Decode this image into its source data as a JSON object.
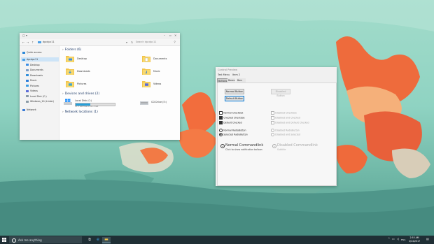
{
  "explorer": {
    "title": "",
    "address_path": "dpcdpc11",
    "search_placeholder": "Search dpcdpc11",
    "nav": {
      "back": "←",
      "forward": "→",
      "up": "↑"
    },
    "sidebar": [
      {
        "label": "Quick access",
        "icon": "star-icon",
        "color": "#2b88d8"
      },
      {
        "label": "dpcdpc11",
        "icon": "computer-icon",
        "color": "#4aa0e6",
        "selected": true
      },
      {
        "label": "Desktop",
        "icon": "desktop-icon",
        "color": "#3a8ee6"
      },
      {
        "label": "Documents",
        "icon": "documents-icon",
        "color": "#7a9cc6"
      },
      {
        "label": "Downloads",
        "icon": "downloads-icon",
        "color": "#2f8fdc"
      },
      {
        "label": "Music",
        "icon": "music-icon",
        "color": "#2b7bd8"
      },
      {
        "label": "Pictures",
        "icon": "pictures-icon",
        "color": "#3b9be3"
      },
      {
        "label": "Videos",
        "icon": "videos-icon",
        "color": "#5b6bd8"
      },
      {
        "label": "Local Disk (C:)",
        "icon": "disk-icon",
        "color": "#8a9aa6"
      },
      {
        "label": "Windows_10 (Linker)",
        "icon": "disk-icon",
        "color": "#8a9aa6"
      },
      {
        "label": "Network",
        "icon": "network-icon",
        "color": "#3a7bd5"
      }
    ],
    "folders_heading": "Folders (6)",
    "folders": [
      {
        "label": "Desktop",
        "icon": "desktop-folder-icon"
      },
      {
        "label": "Documents",
        "icon": "documents-folder-icon"
      },
      {
        "label": "Downloads",
        "icon": "downloads-folder-icon"
      },
      {
        "label": "Music",
        "icon": "music-folder-icon"
      },
      {
        "label": "Pictures",
        "icon": "pictures-folder-icon"
      },
      {
        "label": "Videos",
        "icon": "videos-folder-icon"
      }
    ],
    "drives_heading": "Devices and drives (2)",
    "drives": [
      {
        "label": "Local Disk (C:)",
        "free": "37.7 GB free of 61.3 GB",
        "used_fraction": 0.38
      },
      {
        "label": "CD Drive (E:)",
        "free": "",
        "used_fraction": null
      }
    ],
    "network_heading": "Network locations (1)"
  },
  "preview": {
    "title": "Control Preview",
    "menu": [
      "Test Menu",
      "Item 2"
    ],
    "tabs": [
      "Buttons",
      "Boxes",
      "Bars and Sliders"
    ],
    "buttons": {
      "normal": "Normal Button",
      "default": "Default Button",
      "disabled": "Disabled Button"
    },
    "checkboxes": [
      {
        "label": "Normal Checkbox",
        "checked": false,
        "disabled": false
      },
      {
        "label": "Checked Checkbox",
        "checked": true,
        "disabled": false
      },
      {
        "label": "Default Checked",
        "checked": true,
        "disabled": false
      },
      {
        "label": "Disabled Checkbox",
        "checked": false,
        "disabled": true
      },
      {
        "label": "Disabled and Checked",
        "checked": true,
        "disabled": true
      },
      {
        "label": "Disabled and Default Checked",
        "checked": true,
        "disabled": true
      }
    ],
    "radios": [
      {
        "label": "Normal RadioButton",
        "selected": false,
        "disabled": false
      },
      {
        "label": "Selected RadioButton",
        "selected": true,
        "disabled": false
      },
      {
        "label": "Disabled RadioButton",
        "selected": false,
        "disabled": true
      },
      {
        "label": "Disabled and Selected",
        "selected": true,
        "disabled": true
      }
    ],
    "commandlinks": [
      {
        "title": "Normal Commandlink",
        "subtitle": "Click to show notification balloon",
        "disabled": false
      },
      {
        "title": "Disabled Commandlink",
        "subtitle": "Subtitle",
        "disabled": true
      }
    ]
  },
  "taskbar": {
    "search_placeholder": "Ask me anything",
    "apps": [
      "task-view-icon",
      "edge-icon",
      "explorer-icon"
    ],
    "tray": {
      "lang": "ENG",
      "time": "2:55 AM",
      "date": "4/14/2017"
    }
  },
  "colors": {
    "desktop_sky": "#8fd6c6",
    "desktop_water": "#4f9a8c",
    "accent_orange": "#f06a3a",
    "accent_blue": "#0078d7",
    "taskbar": "#1f2f35"
  }
}
